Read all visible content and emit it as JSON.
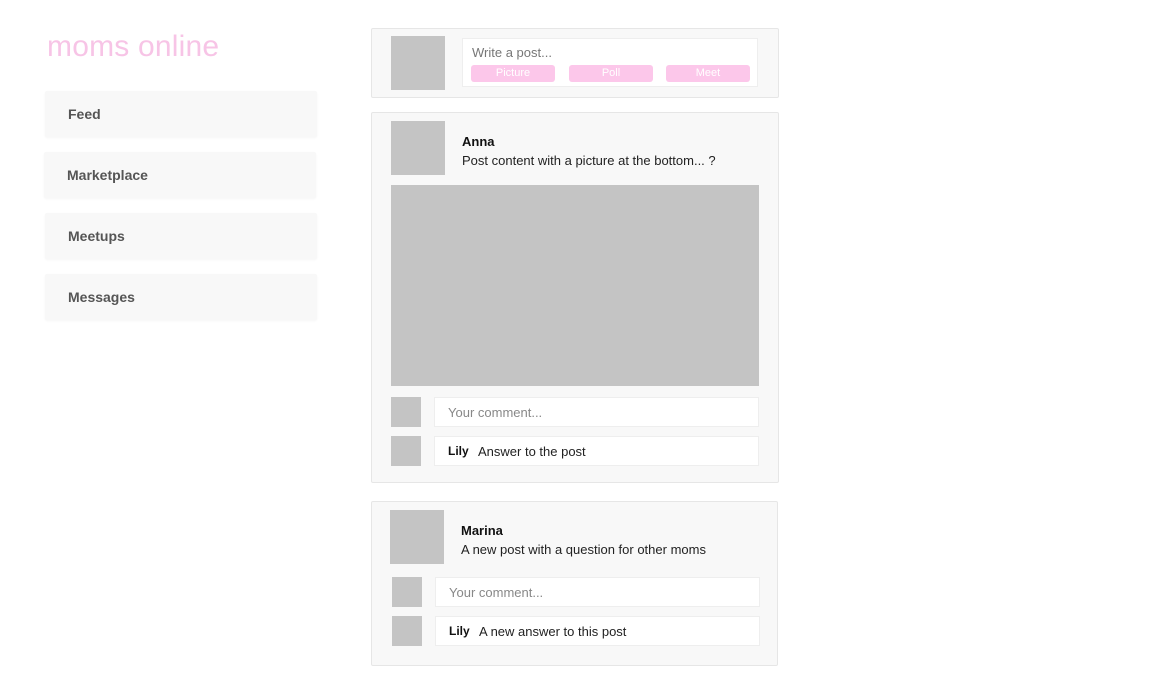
{
  "app": {
    "logo": "moms online"
  },
  "sidebar": {
    "items": [
      {
        "label": "Feed"
      },
      {
        "label": "Marketplace"
      },
      {
        "label": "Meetups"
      },
      {
        "label": "Messages"
      }
    ]
  },
  "composer": {
    "placeholder": "Write a post...",
    "buttons": [
      "Picture",
      "Poll",
      "Meet"
    ]
  },
  "posts": [
    {
      "author": "Anna",
      "text": "Post content with a picture at the bottom... ?",
      "comment_placeholder": "Your comment...",
      "reply": {
        "author": "Lily",
        "text": "Answer to the post"
      }
    },
    {
      "author": "Marina",
      "text": "A new post with a question for other moms",
      "comment_placeholder": "Your comment...",
      "reply": {
        "author": "Lily",
        "text": "A new answer to this post"
      }
    }
  ],
  "colors": {
    "accent": "#f7c4e6",
    "button": "#fcc7ea",
    "placeholder_gray": "#c4c4c4"
  }
}
